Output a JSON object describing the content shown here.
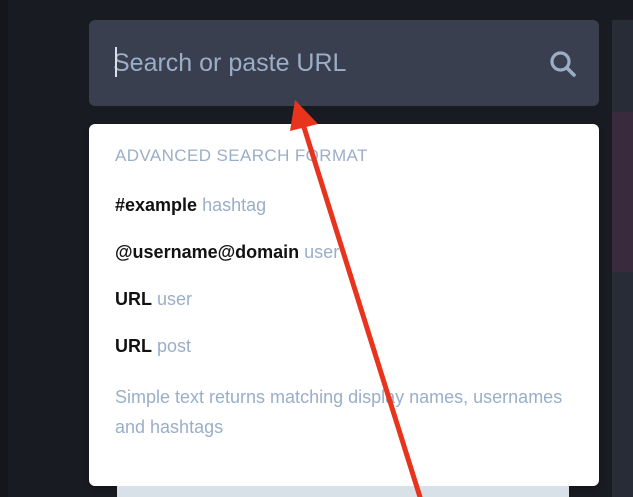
{
  "search": {
    "placeholder": "Search or paste URL",
    "value": "",
    "icon": "search-icon"
  },
  "popout": {
    "heading": "Advanced search format",
    "items": [
      {
        "key": "#example",
        "hint": "hashtag"
      },
      {
        "key": "@username@domain",
        "hint": "user"
      },
      {
        "key": "URL",
        "hint": "user"
      },
      {
        "key": "URL",
        "hint": "post"
      }
    ],
    "note": "Simple text returns matching display names, usernames and hashtags"
  },
  "colors": {
    "background": "#191b22",
    "search_bg": "#393f4f",
    "hint": "#9baec8",
    "key": "#121212",
    "annotation_arrow": "#e8341c"
  }
}
